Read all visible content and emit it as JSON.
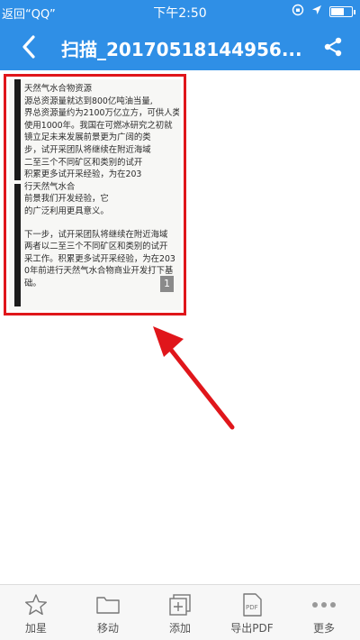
{
  "status_bar": {
    "back_app": "返回“QQ”",
    "time": "下午2:50"
  },
  "nav": {
    "title": "扫描_20170518144956..."
  },
  "document": {
    "page_number": "1",
    "lines": [
      "天然气水合物资源",
      "源总资源量就达到800亿吨油当量,",
      "界总资源量约为2100万亿立方，可供人类",
      "使用1000年。我国在可燃冰研究之初就",
      "镜立足未来发展前景更为广阔的类",
      "步，试开采团队将继续在附近海域",
      "二至三个不同矿区和类别的试开",
      "积累更多试开采经验，为在203",
      "行天然气水合",
      "前景我们开发经验，它",
      "的广泛利用更具意义。"
    ],
    "lines2": [
      "下一步，试开采团队将继续在附近海域",
      "两者以二至三个不同矿区和类别的试开",
      "采工作。积累更多试开采经验，为在203",
      "0年前进行天然气水合物商业开发打下基",
      "础。"
    ]
  },
  "toolbar": {
    "items": [
      {
        "label": "加星",
        "icon": "star-icon"
      },
      {
        "label": "移动",
        "icon": "folder-icon"
      },
      {
        "label": "添加",
        "icon": "add-page-icon"
      },
      {
        "label": "导出PDF",
        "icon": "pdf-icon"
      },
      {
        "label": "更多",
        "icon": "more-icon"
      }
    ]
  },
  "colors": {
    "header": "#2f8fe6",
    "highlight": "#e0161b"
  }
}
